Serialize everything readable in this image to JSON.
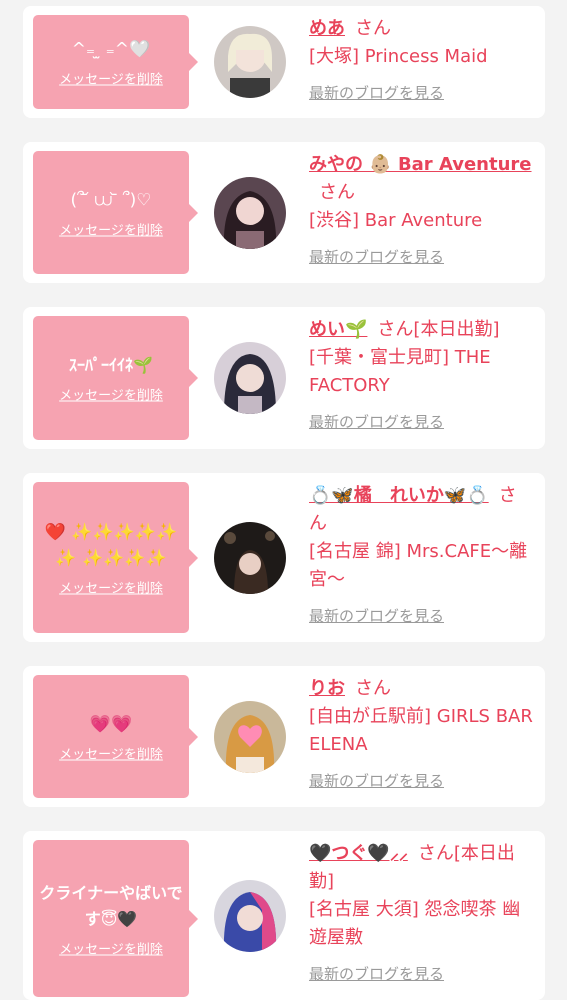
{
  "delete_label": "メッセージを削除",
  "blog_label": "最新のブログを見る",
  "san_label": "さん",
  "accent_color": "#e8435a",
  "bubble_color": "#f6a3b1",
  "cards": [
    {
      "message": "^₌ ̫ ₌^🤍",
      "name": "めあ",
      "status": "",
      "shop": "[大塚] Princess Maid"
    },
    {
      "message": "(՞ ᷄ ⩊ ᷅ ՞)♡",
      "name": "みやの 👶🏼 Bar Aventure",
      "status": "",
      "shop": "[渋谷] Bar Aventure"
    },
    {
      "message": "ｽｰﾊﾟｰｲｲﾈ🌱",
      "name": "めい🌱",
      "status": "[本日出勤]",
      "shop": "[千葉・富士見町] THE FACTORY"
    },
    {
      "message": "❤️ ✨✨✨✨✨✨ ✨✨✨✨",
      "name": "💍🦋橘　れいか🦋💍",
      "status": "",
      "shop": "[名古屋 錦] Mrs.CAFE〜離宮〜"
    },
    {
      "message": "💗💗",
      "name": "りお",
      "status": "",
      "shop": "[自由が丘駅前] GIRLS BAR ELENA"
    },
    {
      "message": "クライナーやばいです😇🖤",
      "name": "🖤つぐ🖤⸝⸝",
      "status": "[本日出勤]",
      "shop": "[名古屋 大須] 怨念喫茶 幽遊屋敷"
    }
  ]
}
